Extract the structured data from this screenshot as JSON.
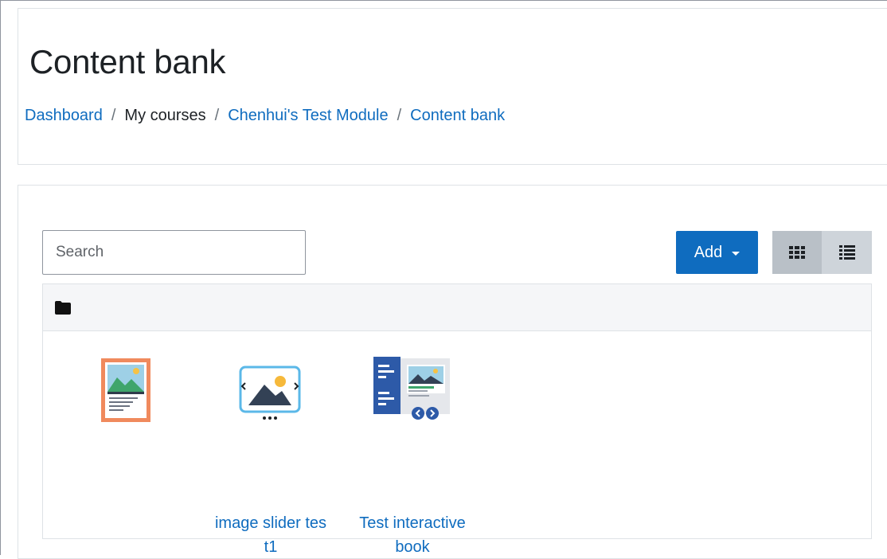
{
  "header": {
    "title": "Content bank",
    "breadcrumb": [
      {
        "label": "Dashboard",
        "link": true
      },
      {
        "label": "My courses",
        "link": false
      },
      {
        "label": "Chenhui's Test Module",
        "link": true
      },
      {
        "label": "Content bank",
        "link": true
      }
    ],
    "separator": "/"
  },
  "toolbar": {
    "search_placeholder": "Search",
    "add_label": "Add",
    "views": [
      "grid-view",
      "list-view"
    ],
    "active_view": "grid-view"
  },
  "files": [
    {
      "name": "",
      "icon": "image-hotspots-icon"
    },
    {
      "name_line1": "image slider tes",
      "name_line2": "t1",
      "icon": "image-slider-icon"
    },
    {
      "name_line1": "Test interactive",
      "name_line2": "book",
      "icon": "interactive-book-icon"
    }
  ],
  "colors": {
    "link": "#0f6cbf",
    "primary": "#0f6cbf",
    "border": "#dee2e6"
  }
}
